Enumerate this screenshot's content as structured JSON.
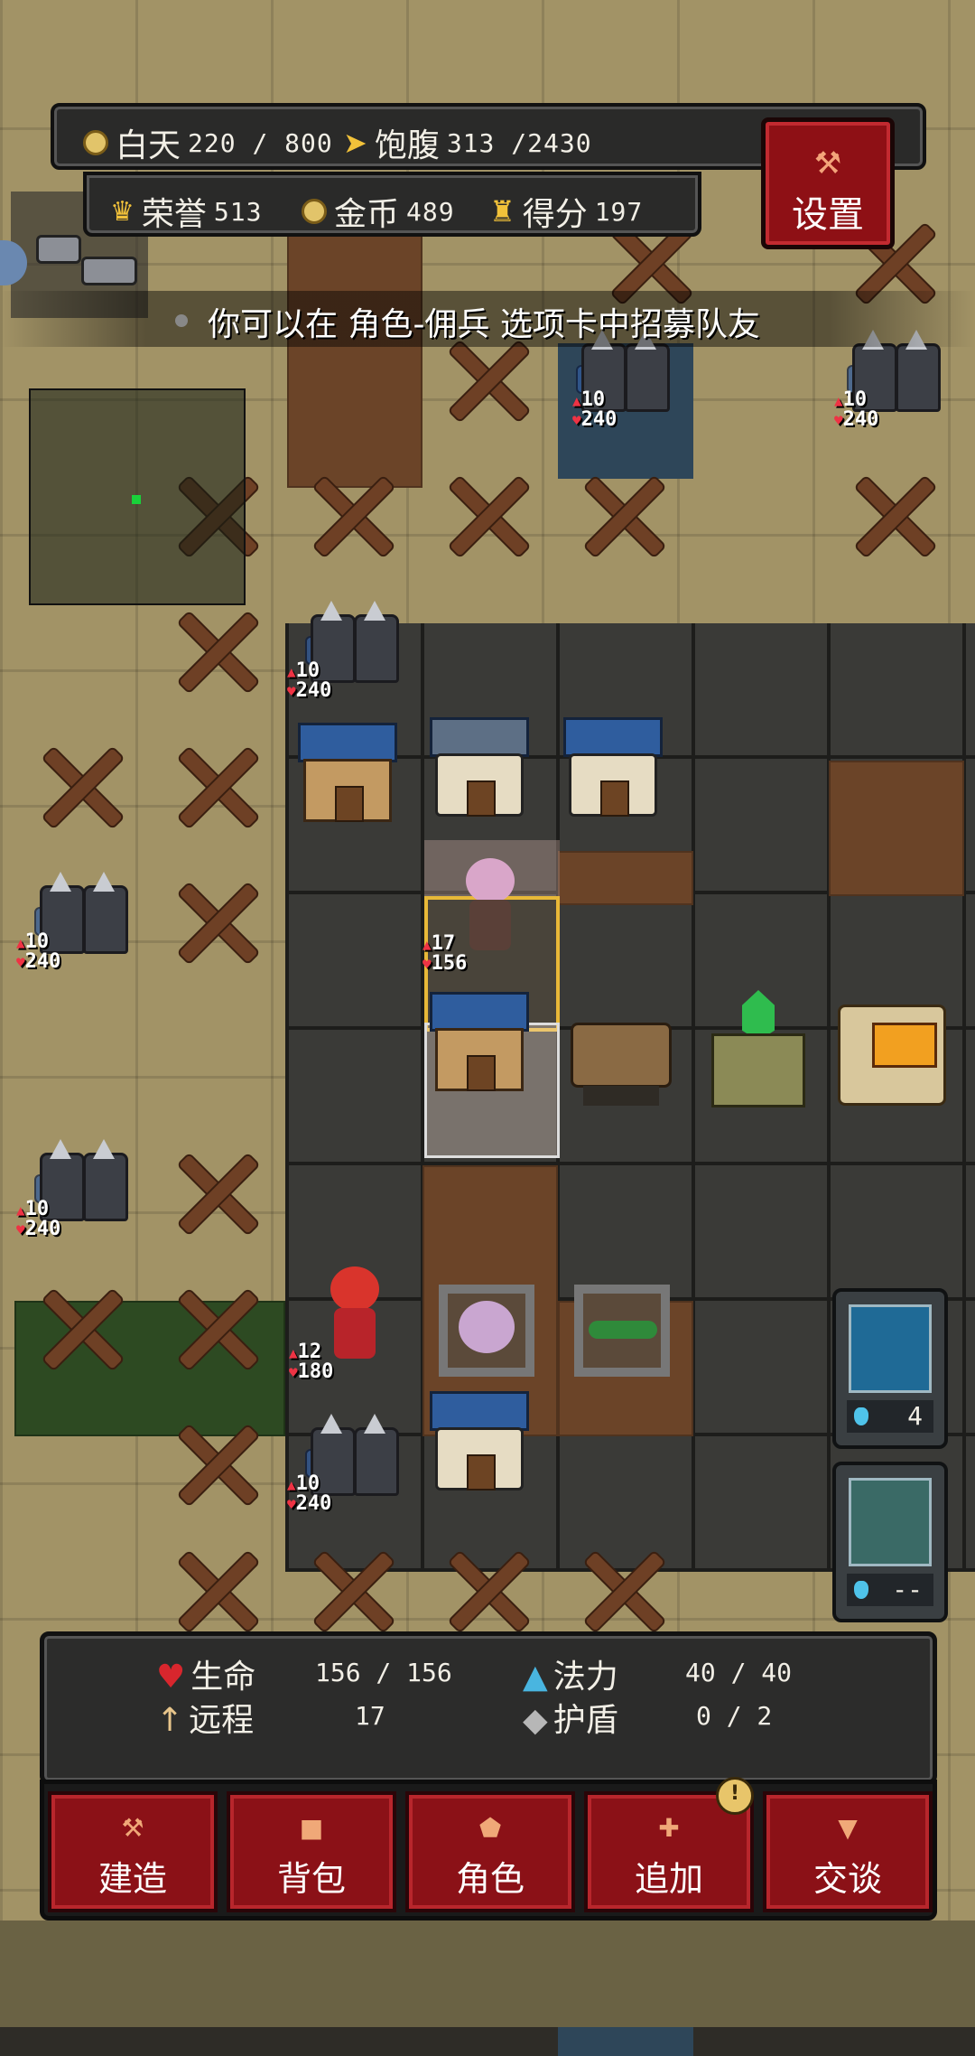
{
  "hud": {
    "day_label": "白天",
    "day_value": "220 / 800",
    "hunger_label": "饱腹",
    "hunger_value": "313 /2430",
    "honor_label": "荣誉",
    "honor_value": "513",
    "gold_label": "金币",
    "gold_value": "489",
    "score_label": "得分",
    "score_value": "197"
  },
  "settings": {
    "label": "设置",
    "icon": "wrench-icon"
  },
  "hint": "你可以在 角色-佣兵 选项卡中招募队友",
  "units": {
    "squad_attack": "10",
    "squad_hp": "240",
    "hero_attack": "17",
    "hero_hp": "156",
    "ally_attack": "12",
    "ally_hp": "180"
  },
  "skills": [
    {
      "name": "lightning-skill",
      "cost": "4"
    },
    {
      "name": "shield-skill",
      "cost": "--"
    }
  ],
  "stats": {
    "hp_label": "生命",
    "hp_value": "156 / 156",
    "mana_label": "法力",
    "mana_value": "40 / 40",
    "ranged_label": "远程",
    "ranged_value": "17",
    "shield_label": "护盾",
    "shield_value": "0 / 2"
  },
  "menu": {
    "build": "建造",
    "bag": "背包",
    "character": "角色",
    "add": "追加",
    "talk": "交谈",
    "alert": "!"
  },
  "colors": {
    "accent_red": "#8b1117",
    "hud_bg": "#2a2a29",
    "gold": "#f2c23a",
    "minimap_marker": "#19d23a"
  }
}
